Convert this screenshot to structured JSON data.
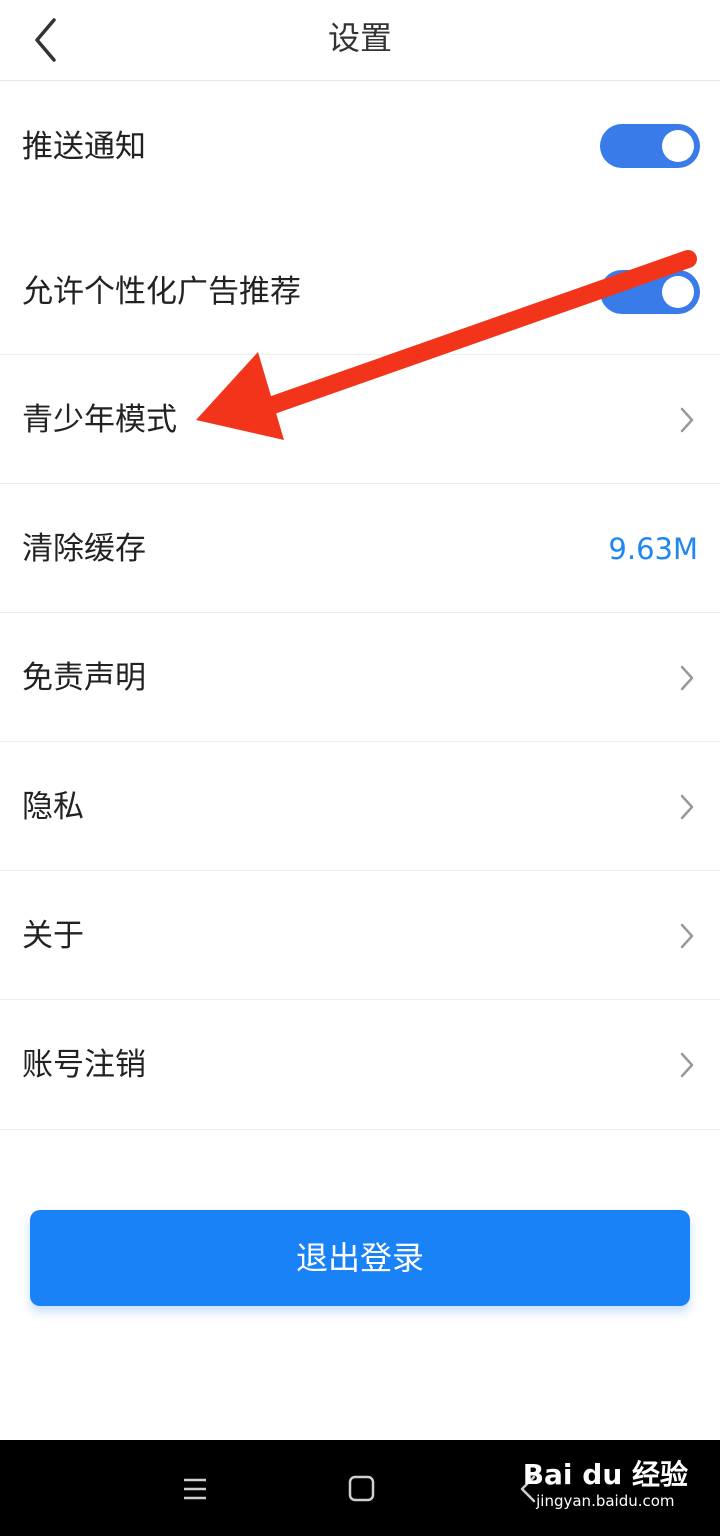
{
  "header": {
    "title": "设置",
    "back_icon": "chevron-left-icon"
  },
  "settings": {
    "push": {
      "label": "推送通知",
      "enabled": true
    },
    "ads": {
      "label": "允许个性化广告推荐",
      "enabled": true
    },
    "youth": {
      "label": "青少年模式"
    },
    "cache": {
      "label": "清除缓存",
      "value": "9.63M"
    },
    "disclaimer": {
      "label": "免责声明"
    },
    "privacy": {
      "label": "隐私"
    },
    "about": {
      "label": "关于"
    },
    "account": {
      "label": "账号注销"
    }
  },
  "logout": {
    "label": "退出登录"
  },
  "colors": {
    "accent": "#1a82f7",
    "toggle_on": "#3a7bea",
    "value_text": "#1e88f0",
    "annotation_arrow": "#f2351a",
    "navbar": "#000000"
  },
  "navbar": {
    "icons": [
      "menu-icon",
      "home-square-icon",
      "back-triangle-icon"
    ]
  },
  "watermark": {
    "logo": "Bai du 经验",
    "url": "jingyan.baidu.com"
  }
}
